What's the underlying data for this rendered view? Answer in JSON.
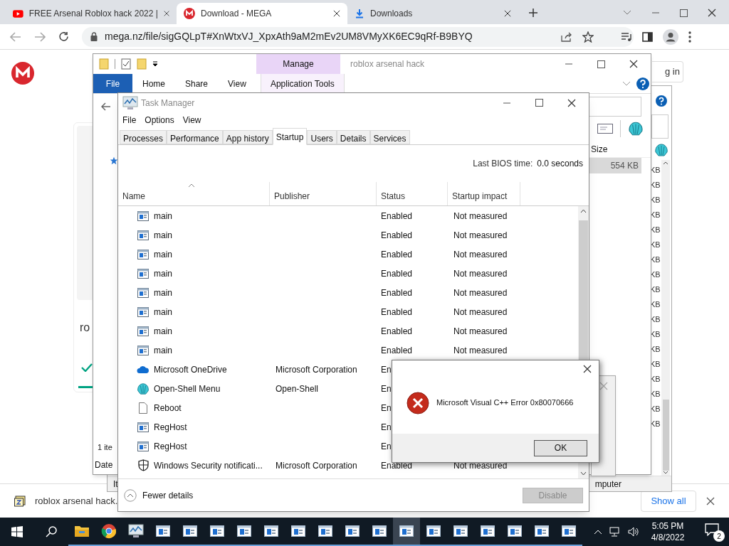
{
  "browser": {
    "tabs": [
      {
        "title": "FREE Arsenal Roblox hack 2022 |",
        "kind": "video",
        "selected": false
      },
      {
        "title": "Download - MEGA",
        "kind": "mega",
        "selected": true
      },
      {
        "title": "Downloads",
        "kind": "download",
        "selected": false
      }
    ],
    "address": "mega.nz/file/sigGQLpT#XnWtxVJ_XpxAth9aM2mEv2UM8VMyXK6EC9qRf-B9BYQ",
    "page": {
      "card_text": "ro",
      "login_text": "g in",
      "progress": {
        "level": 1
      }
    },
    "download_bar": {
      "file": "roblox arsenal hack.",
      "button": "Show all"
    }
  },
  "explorer": {
    "title": "roblox arsenal hack",
    "contextual_tab": "Manage",
    "tabs": [
      {
        "label": "File",
        "selected": true
      },
      {
        "label": "Home",
        "selected": false
      },
      {
        "label": "Share",
        "selected": false
      },
      {
        "label": "View",
        "selected": false
      },
      {
        "label": "Application Tools",
        "selected": false
      }
    ],
    "size_header": "Size",
    "selected_size": "554 KB",
    "status_left": "1 ite",
    "column_left": "Date"
  },
  "explorer_back": {
    "sizes": [
      "KB",
      "KB",
      "KB",
      "KB",
      "KB",
      "KB",
      "KB",
      "KB",
      "KB",
      "KB",
      "KB",
      "KB",
      "KB",
      "KB",
      "KB",
      "KB",
      "KB",
      "KB"
    ],
    "bottom_left": "It",
    "bottom_right": "mputer"
  },
  "task_manager": {
    "title": "Task Manager",
    "menu": [
      "File",
      "Options",
      "View"
    ],
    "tabs": [
      {
        "label": "Processes",
        "selected": false
      },
      {
        "label": "Performance",
        "selected": false
      },
      {
        "label": "App history",
        "selected": false
      },
      {
        "label": "Startup",
        "selected": true
      },
      {
        "label": "Users",
        "selected": false
      },
      {
        "label": "Details",
        "selected": false
      },
      {
        "label": "Services",
        "selected": false
      }
    ],
    "bios_label": "Last BIOS time:",
    "bios_value": "0.0 seconds",
    "columns": [
      "Name",
      "Publisher",
      "Status",
      "Startup impact"
    ],
    "rows": [
      {
        "kind": "app",
        "name": "main",
        "status": "Enabled",
        "impact": "Not measured"
      },
      {
        "kind": "app",
        "name": "main",
        "status": "Enabled",
        "impact": "Not measured"
      },
      {
        "kind": "app",
        "name": "main",
        "status": "Enabled",
        "impact": "Not measured"
      },
      {
        "kind": "app",
        "name": "main",
        "status": "Enabled",
        "impact": "Not measured"
      },
      {
        "kind": "app",
        "name": "main",
        "status": "Enabled",
        "impact": "Not measured"
      },
      {
        "kind": "app",
        "name": "main",
        "status": "Enabled",
        "impact": "Not measured"
      },
      {
        "kind": "app",
        "name": "main",
        "status": "Enabled",
        "impact": "Not measured"
      },
      {
        "kind": "app",
        "name": "main",
        "status": "Enabled",
        "impact": "Not measured"
      },
      {
        "kind": "cloud",
        "name": "Microsoft OneDrive",
        "publisher": "Microsoft Corporation",
        "status": "En"
      },
      {
        "kind": "shell",
        "name": "Open-Shell Menu",
        "publisher": "Open-Shell",
        "status": "En"
      },
      {
        "kind": "file",
        "name": "Reboot",
        "status": "En"
      },
      {
        "kind": "app",
        "name": "RegHost",
        "status": "En"
      },
      {
        "kind": "app",
        "name": "RegHost",
        "status": "En"
      },
      {
        "kind": "shield",
        "name": "Windows Security notificati...",
        "publisher": "Microsoft Corporation",
        "status": "Enabled",
        "impact": "Not measured"
      }
    ],
    "footer": {
      "toggle": "Fewer details",
      "button": {
        "label": "Disable",
        "disabled": true
      }
    }
  },
  "error_dialog": {
    "message": "Microsoft Visual C++ Error 0x80070666",
    "button": "OK"
  },
  "taskbar": {
    "apps": [
      {
        "kind": "folder",
        "selected": false
      },
      {
        "kind": "chrome",
        "selected": false
      },
      {
        "kind": "monitor",
        "selected": false
      },
      {
        "kind": "app",
        "selected": false
      },
      {
        "kind": "app",
        "selected": false
      },
      {
        "kind": "app",
        "selected": false
      },
      {
        "kind": "app",
        "selected": false
      },
      {
        "kind": "app",
        "selected": false
      },
      {
        "kind": "app",
        "selected": false
      },
      {
        "kind": "app",
        "selected": false
      },
      {
        "kind": "app",
        "selected": false
      },
      {
        "kind": "app",
        "selected": false
      },
      {
        "kind": "app",
        "selected": true
      },
      {
        "kind": "app",
        "selected": false
      },
      {
        "kind": "app",
        "selected": false
      },
      {
        "kind": "app",
        "selected": false
      },
      {
        "kind": "app",
        "selected": false
      },
      {
        "kind": "app",
        "selected": false
      },
      {
        "kind": "app",
        "selected": false
      }
    ],
    "time": "5:05 PM",
    "date": "4/8/2022",
    "notifications": "2"
  }
}
